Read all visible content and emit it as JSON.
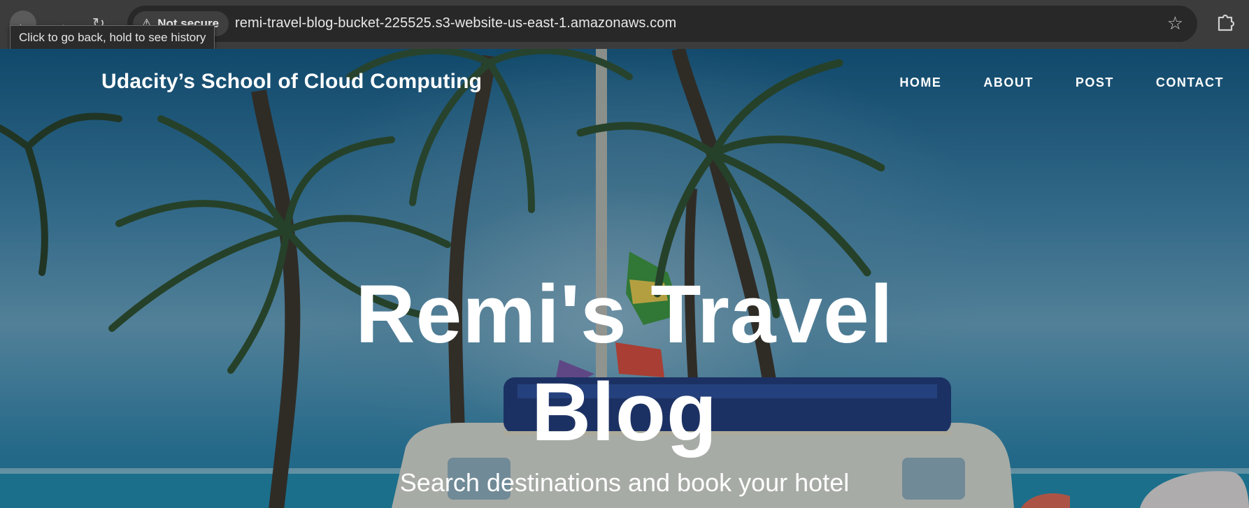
{
  "browser": {
    "security_label": "Not secure",
    "url": "remi-travel-blog-bucket-225525.s3-website-us-east-1.amazonaws.com",
    "tooltip": "Click to go back, hold to see history",
    "icons": {
      "back": "back-arrow-icon",
      "forward": "forward-arrow-icon",
      "reload": "reload-icon",
      "warning": "warning-triangle-icon",
      "bookmark": "star-icon",
      "extensions": "puzzle-piece-icon"
    }
  },
  "site": {
    "brand": "Udacity’s School of Cloud Computing",
    "nav": [
      "HOME",
      "ABOUT",
      "POST",
      "CONTACT"
    ],
    "hero": {
      "title_line1": "Remi's Travel",
      "title_line2": "Blog",
      "subtitle": "Search destinations and book your hotel"
    }
  }
}
